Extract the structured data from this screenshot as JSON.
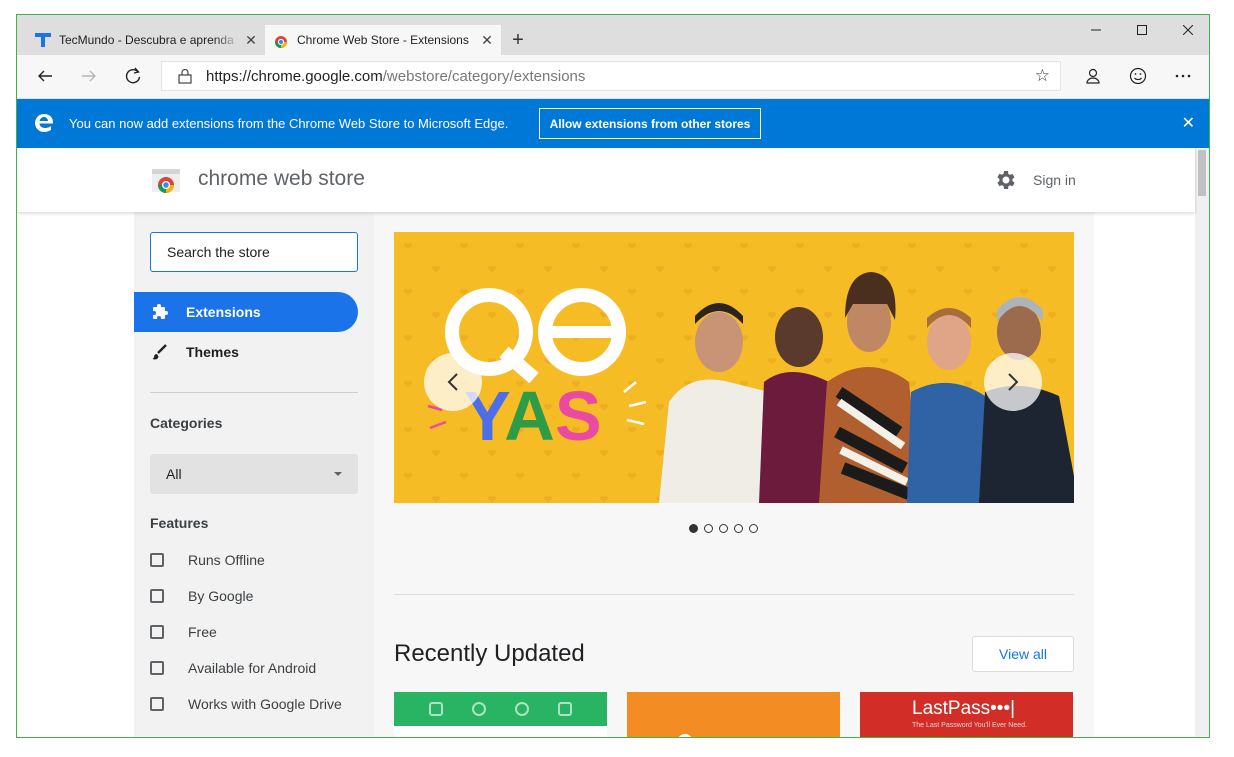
{
  "browser": {
    "tabs": [
      {
        "title": "TecMundo - Descubra e aprenda",
        "active": false
      },
      {
        "title": "Chrome Web Store - Extensions",
        "active": true
      }
    ],
    "url_host": "https://chrome.google.com",
    "url_path": "/webstore/category/extensions"
  },
  "infobar": {
    "message": "You can now add extensions from the Chrome Web Store to Microsoft Edge.",
    "button": "Allow extensions from other stores"
  },
  "store": {
    "title": "chrome web store",
    "signin": "Sign in",
    "search_placeholder": "Search the store",
    "nav": [
      "Extensions",
      "Themes"
    ],
    "categories_label": "Categories",
    "category_selected": "All",
    "features_label": "Features",
    "features": [
      "Runs Offline",
      "By Google",
      "Free",
      "Available for Android",
      "Works with Google Drive"
    ],
    "banner": {
      "logo_top": "QE",
      "logo_bottom": "YAS",
      "slides": 5,
      "current_slide": 1
    },
    "recent_title": "Recently Updated",
    "view_all": "View all",
    "lastpass": {
      "name": "LastPass•••|",
      "tagline": "The Last Password You'll Ever Need."
    }
  },
  "colors": {
    "edge_blue": "#0078d7",
    "google_blue": "#1a73e8",
    "banner_yellow": "#f6bc26"
  }
}
